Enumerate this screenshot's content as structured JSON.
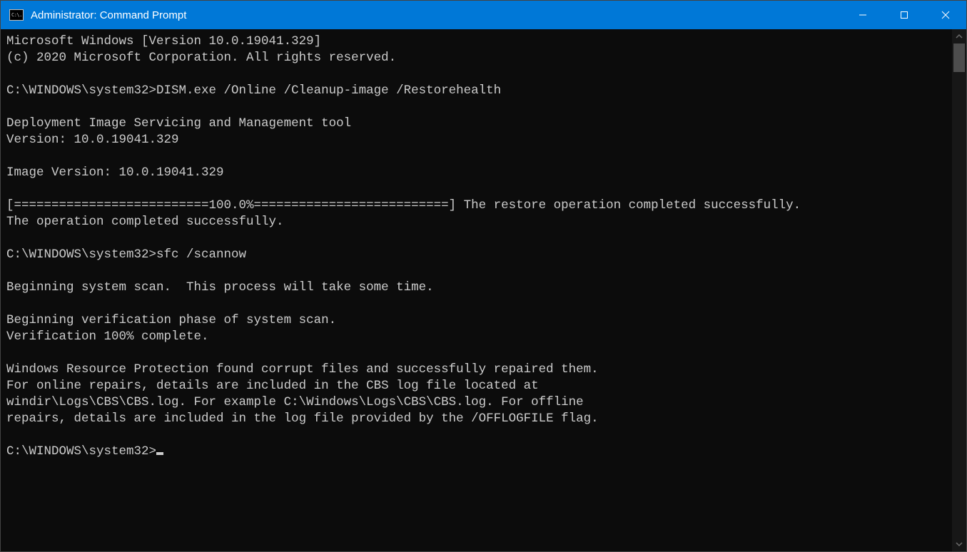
{
  "titlebar": {
    "icon_text": "C:\\.",
    "title": "Administrator: Command Prompt"
  },
  "console": {
    "lines": [
      "Microsoft Windows [Version 10.0.19041.329]",
      "(c) 2020 Microsoft Corporation. All rights reserved.",
      "",
      "C:\\WINDOWS\\system32>DISM.exe /Online /Cleanup-image /Restorehealth",
      "",
      "Deployment Image Servicing and Management tool",
      "Version: 10.0.19041.329",
      "",
      "Image Version: 10.0.19041.329",
      "",
      "[==========================100.0%==========================] The restore operation completed successfully.",
      "The operation completed successfully.",
      "",
      "C:\\WINDOWS\\system32>sfc /scannow",
      "",
      "Beginning system scan.  This process will take some time.",
      "",
      "Beginning verification phase of system scan.",
      "Verification 100% complete.",
      "",
      "Windows Resource Protection found corrupt files and successfully repaired them.",
      "For online repairs, details are included in the CBS log file located at",
      "windir\\Logs\\CBS\\CBS.log. For example C:\\Windows\\Logs\\CBS\\CBS.log. For offline",
      "repairs, details are included in the log file provided by the /OFFLOGFILE flag.",
      "",
      "C:\\WINDOWS\\system32>"
    ]
  }
}
